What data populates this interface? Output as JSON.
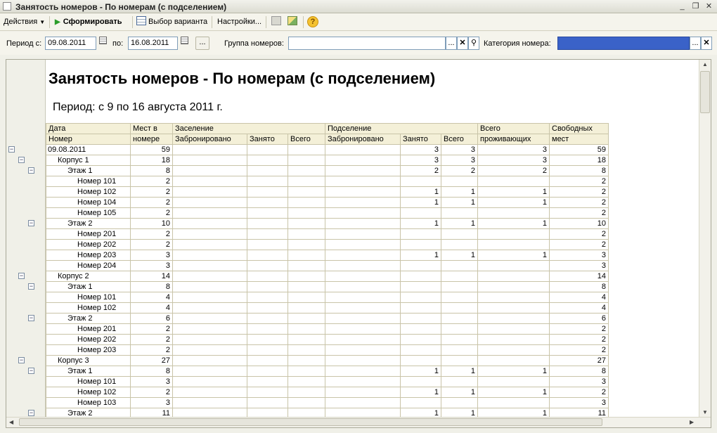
{
  "window": {
    "title": "Занятость номеров - По номерам (с подселением)"
  },
  "toolbar": {
    "actions_label": "Действия",
    "generate_label": "Сформировать",
    "variant_label": "Выбор варианта",
    "settings_label": "Настройки..."
  },
  "params": {
    "period_from_label": "Период с:",
    "period_from_value": "09.08.2011",
    "period_to_label": "по:",
    "period_to_value": "16.08.2011",
    "room_group_label": "Группа номеров:",
    "room_group_value": "",
    "room_category_label": "Категория номера:",
    "room_category_value": ""
  },
  "report": {
    "title": "Занятость номеров - По номерам (с подселением)",
    "period_text": "Период: с 9 по 16 августа 2011 г.",
    "headers": {
      "date": "Дата",
      "room": "Номер",
      "places_1": "Мест в",
      "places_2": "номере",
      "checkin": "Заселение",
      "sharing": "Подселение",
      "booked": "Забронировано",
      "occupied": "Занято",
      "total": "Всего",
      "total_living_1": "Всего",
      "total_living_2": "проживающих",
      "free_1": "Свободных",
      "free_2": "мест"
    },
    "rows": [
      {
        "name": "09.08.2011",
        "level": 0,
        "places": "59",
        "cb": "",
        "co": "",
        "ct": "",
        "sb": "",
        "so": "3",
        "st": "3",
        "live": "3",
        "free": "59"
      },
      {
        "name": "Корпус 1",
        "level": 1,
        "places": "18",
        "cb": "",
        "co": "",
        "ct": "",
        "sb": "",
        "so": "3",
        "st": "3",
        "live": "3",
        "free": "18"
      },
      {
        "name": "Этаж 1",
        "level": 2,
        "places": "8",
        "cb": "",
        "co": "",
        "ct": "",
        "sb": "",
        "so": "2",
        "st": "2",
        "live": "2",
        "free": "8"
      },
      {
        "name": "Номер 101",
        "level": 3,
        "places": "2",
        "cb": "",
        "co": "",
        "ct": "",
        "sb": "",
        "so": "",
        "st": "",
        "live": "",
        "free": "2"
      },
      {
        "name": "Номер 102",
        "level": 3,
        "places": "2",
        "cb": "",
        "co": "",
        "ct": "",
        "sb": "",
        "so": "1",
        "st": "1",
        "live": "1",
        "free": "2"
      },
      {
        "name": "Номер 104",
        "level": 3,
        "places": "2",
        "cb": "",
        "co": "",
        "ct": "",
        "sb": "",
        "so": "1",
        "st": "1",
        "live": "1",
        "free": "2"
      },
      {
        "name": "Номер 105",
        "level": 3,
        "places": "2",
        "cb": "",
        "co": "",
        "ct": "",
        "sb": "",
        "so": "",
        "st": "",
        "live": "",
        "free": "2"
      },
      {
        "name": "Этаж 2",
        "level": 2,
        "places": "10",
        "cb": "",
        "co": "",
        "ct": "",
        "sb": "",
        "so": "1",
        "st": "1",
        "live": "1",
        "free": "10"
      },
      {
        "name": "Номер 201",
        "level": 3,
        "places": "2",
        "cb": "",
        "co": "",
        "ct": "",
        "sb": "",
        "so": "",
        "st": "",
        "live": "",
        "free": "2"
      },
      {
        "name": "Номер 202",
        "level": 3,
        "places": "2",
        "cb": "",
        "co": "",
        "ct": "",
        "sb": "",
        "so": "",
        "st": "",
        "live": "",
        "free": "2"
      },
      {
        "name": "Номер 203",
        "level": 3,
        "places": "3",
        "cb": "",
        "co": "",
        "ct": "",
        "sb": "",
        "so": "1",
        "st": "1",
        "live": "1",
        "free": "3"
      },
      {
        "name": "Номер 204",
        "level": 3,
        "places": "3",
        "cb": "",
        "co": "",
        "ct": "",
        "sb": "",
        "so": "",
        "st": "",
        "live": "",
        "free": "3"
      },
      {
        "name": "Корпус 2",
        "level": 1,
        "places": "14",
        "cb": "",
        "co": "",
        "ct": "",
        "sb": "",
        "so": "",
        "st": "",
        "live": "",
        "free": "14"
      },
      {
        "name": "Этаж 1",
        "level": 2,
        "places": "8",
        "cb": "",
        "co": "",
        "ct": "",
        "sb": "",
        "so": "",
        "st": "",
        "live": "",
        "free": "8"
      },
      {
        "name": "Номер 101",
        "level": 3,
        "places": "4",
        "cb": "",
        "co": "",
        "ct": "",
        "sb": "",
        "so": "",
        "st": "",
        "live": "",
        "free": "4"
      },
      {
        "name": "Номер 102",
        "level": 3,
        "places": "4",
        "cb": "",
        "co": "",
        "ct": "",
        "sb": "",
        "so": "",
        "st": "",
        "live": "",
        "free": "4"
      },
      {
        "name": "Этаж 2",
        "level": 2,
        "places": "6",
        "cb": "",
        "co": "",
        "ct": "",
        "sb": "",
        "so": "",
        "st": "",
        "live": "",
        "free": "6"
      },
      {
        "name": "Номер 201",
        "level": 3,
        "places": "2",
        "cb": "",
        "co": "",
        "ct": "",
        "sb": "",
        "so": "",
        "st": "",
        "live": "",
        "free": "2"
      },
      {
        "name": "Номер 202",
        "level": 3,
        "places": "2",
        "cb": "",
        "co": "",
        "ct": "",
        "sb": "",
        "so": "",
        "st": "",
        "live": "",
        "free": "2"
      },
      {
        "name": "Номер 203",
        "level": 3,
        "places": "2",
        "cb": "",
        "co": "",
        "ct": "",
        "sb": "",
        "so": "",
        "st": "",
        "live": "",
        "free": "2"
      },
      {
        "name": "Корпус 3",
        "level": 1,
        "places": "27",
        "cb": "",
        "co": "",
        "ct": "",
        "sb": "",
        "so": "",
        "st": "",
        "live": "",
        "free": "27"
      },
      {
        "name": "Этаж 1",
        "level": 2,
        "places": "8",
        "cb": "",
        "co": "",
        "ct": "",
        "sb": "",
        "so": "1",
        "st": "1",
        "live": "1",
        "free": "8"
      },
      {
        "name": "Номер 101",
        "level": 3,
        "places": "3",
        "cb": "",
        "co": "",
        "ct": "",
        "sb": "",
        "so": "",
        "st": "",
        "live": "",
        "free": "3"
      },
      {
        "name": "Номер 102",
        "level": 3,
        "places": "2",
        "cb": "",
        "co": "",
        "ct": "",
        "sb": "",
        "so": "1",
        "st": "1",
        "live": "1",
        "free": "2"
      },
      {
        "name": "Номер 103",
        "level": 3,
        "places": "3",
        "cb": "",
        "co": "",
        "ct": "",
        "sb": "",
        "so": "",
        "st": "",
        "live": "",
        "free": "3"
      },
      {
        "name": "Этаж 2",
        "level": 2,
        "places": "11",
        "cb": "",
        "co": "",
        "ct": "",
        "sb": "",
        "so": "1",
        "st": "1",
        "live": "1",
        "free": "11"
      }
    ]
  },
  "colors": {
    "header_fill": "#f4f0d8",
    "grid_line": "#c9c4a8",
    "category_selection": "#3a62c8",
    "generate_icon": "#2a9d2a"
  }
}
